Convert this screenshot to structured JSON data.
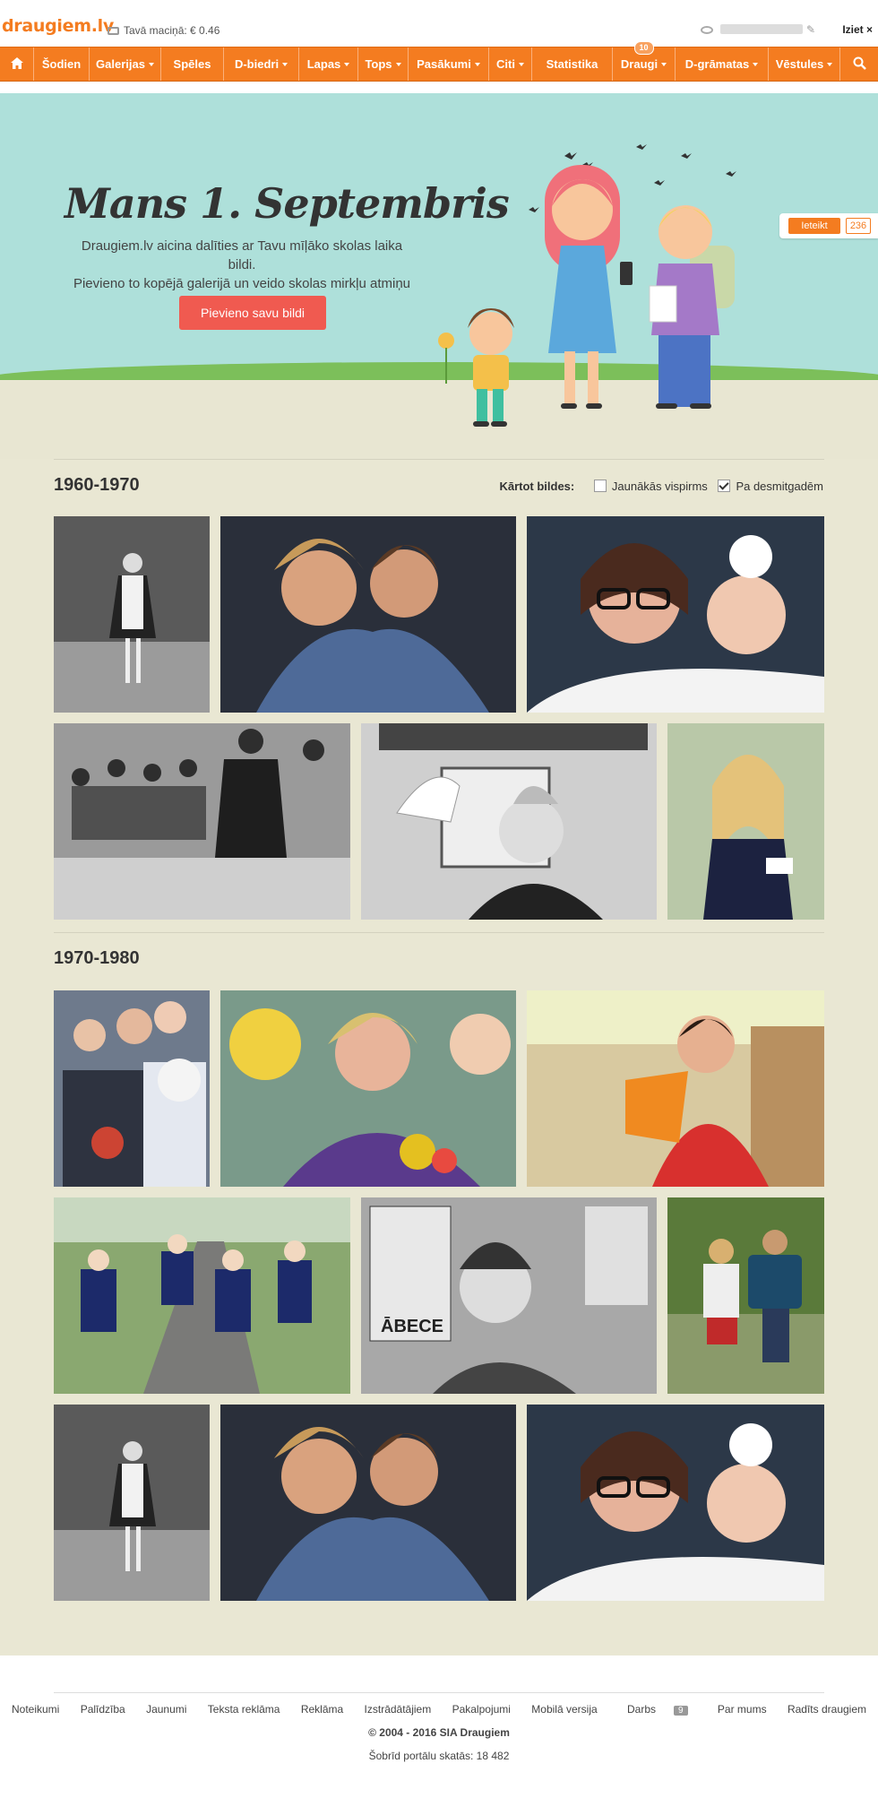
{
  "header": {
    "logo": "draugiem.lv",
    "wallet_label": "Tavā maciņā: € 0.46",
    "logout": "Iziet ×"
  },
  "nav": {
    "items": [
      {
        "label": "Šodien",
        "caret": false
      },
      {
        "label": "Galerijas",
        "caret": true
      },
      {
        "label": "Spēles",
        "caret": false
      },
      {
        "label": "D-biedri",
        "caret": true
      },
      {
        "label": "Lapas",
        "caret": true
      },
      {
        "label": "Tops",
        "caret": true
      },
      {
        "label": "Pasākumi",
        "caret": true
      },
      {
        "label": "Citi",
        "caret": true
      },
      {
        "label": "Statistika",
        "caret": false
      },
      {
        "label": "Draugi",
        "caret": true,
        "badge": "10"
      },
      {
        "label": "D-grāmatas",
        "caret": true
      },
      {
        "label": "Vēstules",
        "caret": true
      }
    ]
  },
  "hero": {
    "title": "Mans 1. Septembris",
    "text_line1": "Draugiem.lv aicina dalīties ar Tavu mīļāko skolas laika bildi.",
    "text_line2": "Pievieno to kopējā galerijā un veido skolas mirkļu atmiņu kladi",
    "button": "Pievieno savu bildi",
    "like_label": "Ieteikt",
    "like_count": "236"
  },
  "sort": {
    "label": "Kārtot bildes:",
    "option1": "Jaunākās vispirms",
    "option2": "Pa desmitgadēm"
  },
  "sections": [
    {
      "title": "1960-1970"
    },
    {
      "title": "1970-1980"
    }
  ],
  "footer": {
    "links": [
      "Noteikumi",
      "Palīdzība",
      "Jaunumi",
      "Teksta reklāma",
      "Reklāma",
      "Izstrādātājiem",
      "Pakalpojumi",
      "Mobilā versija",
      "Darbs",
      "Par mums",
      "Radīts draugiem"
    ],
    "darbs_badge": "9",
    "copyright": "© 2004 - 2016 SIA Draugiem",
    "views": "Šobrīd portālu skatās: 18 482"
  },
  "colors": {
    "brand": "#f47c20",
    "hero_bg": "#aee0da",
    "page_bg": "#e9e7d3",
    "button": "#f05a50"
  }
}
